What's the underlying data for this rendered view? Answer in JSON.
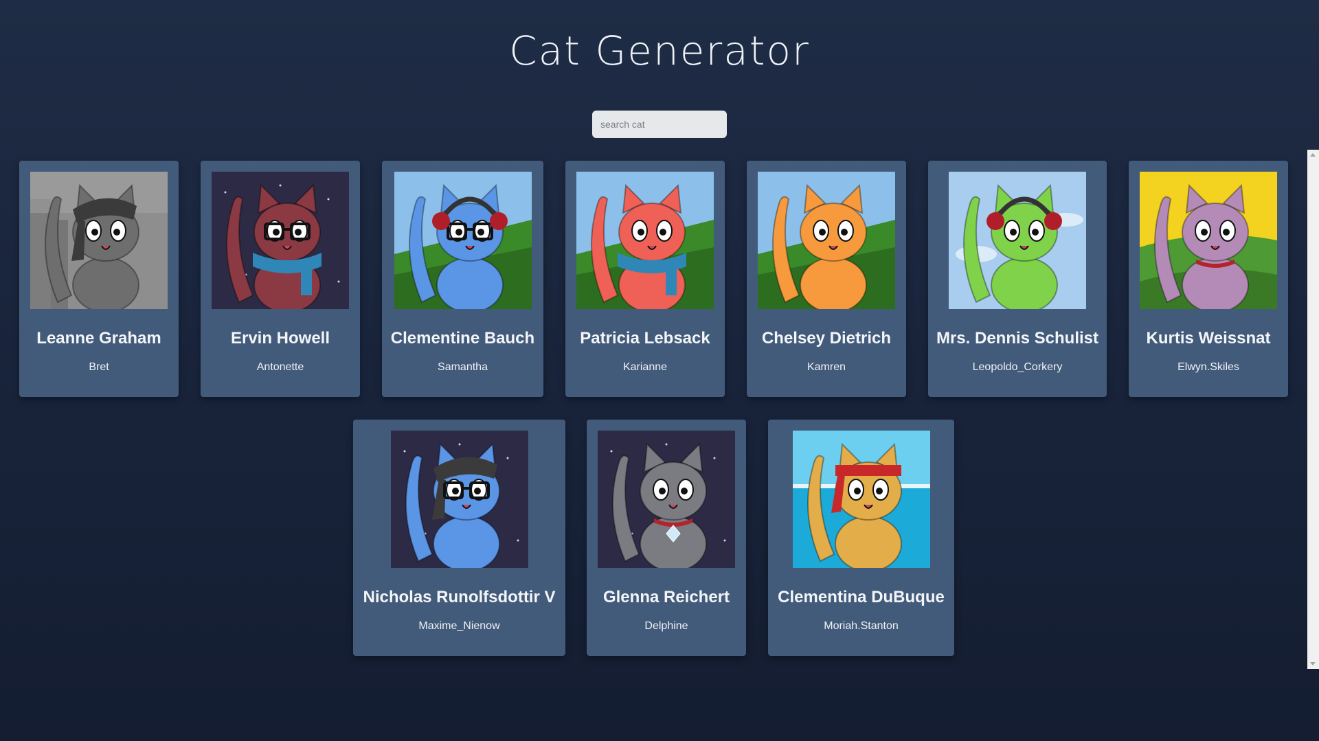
{
  "app": {
    "title": "Cat Generator"
  },
  "search": {
    "placeholder": "search cat",
    "value": ""
  },
  "cats": [
    {
      "name": "Leanne Graham",
      "username": "Bret",
      "body_color": "#6e6e6e",
      "bg": "gray-city",
      "accessory": "bandana"
    },
    {
      "name": "Ervin Howell",
      "username": "Antonette",
      "body_color": "#8b3a44",
      "bg": "night",
      "accessory": "glasses-scarf"
    },
    {
      "name": "Clementine Bauch",
      "username": "Samantha",
      "body_color": "#5b95e6",
      "bg": "hills",
      "accessory": "headphones-glasses"
    },
    {
      "name": "Patricia Lebsack",
      "username": "Karianne",
      "body_color": "#ef6157",
      "bg": "hills",
      "accessory": "scarf"
    },
    {
      "name": "Chelsey Dietrich",
      "username": "Kamren",
      "body_color": "#f79a3e",
      "bg": "hills",
      "accessory": "none"
    },
    {
      "name": "Mrs. Dennis Schulist",
      "username": "Leopoldo_Corkery",
      "body_color": "#7fd24a",
      "bg": "sky",
      "accessory": "headphones"
    },
    {
      "name": "Kurtis Weissnat",
      "username": "Elwyn.Skiles",
      "body_color": "#b38bb6",
      "bg": "sunny-hills",
      "accessory": "collar"
    },
    {
      "name": "Nicholas Runolfsdottir V",
      "username": "Maxime_Nienow",
      "body_color": "#5b95e6",
      "bg": "night",
      "accessory": "bandana-glasses"
    },
    {
      "name": "Glenna Reichert",
      "username": "Delphine",
      "body_color": "#7b7b82",
      "bg": "night",
      "accessory": "collar-gem"
    },
    {
      "name": "Clementina DuBuque",
      "username": "Moriah.Stanton",
      "body_color": "#e3ad4a",
      "bg": "ocean",
      "accessory": "headband"
    }
  ]
}
